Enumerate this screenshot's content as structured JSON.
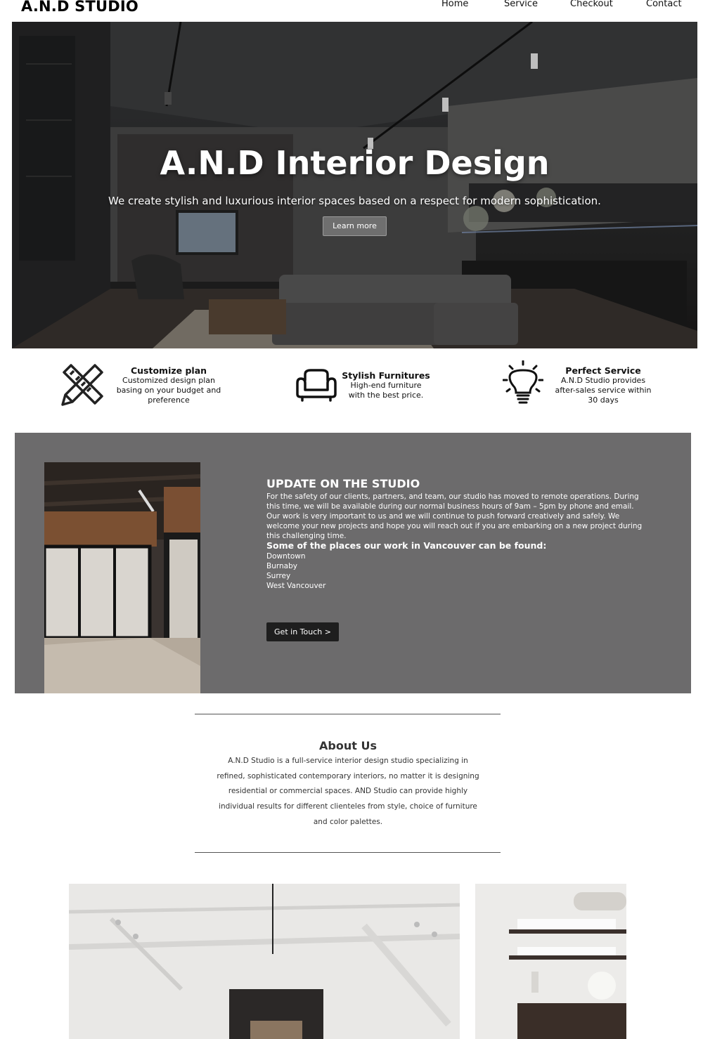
{
  "brand": "A.N.D STUDIO",
  "nav": [
    "Home",
    "Service",
    "Checkout",
    "Contact"
  ],
  "hero": {
    "title": "A.N.D Interior Design",
    "subtitle": "We create stylish and luxurious interior spaces based on a respect for modern sophistication.",
    "button": "Learn more"
  },
  "features": [
    {
      "icon": "ruler-pencil-icon",
      "title": "Customize plan",
      "lines": [
        "Customized design plan",
        "basing on your budget and",
        "preference"
      ]
    },
    {
      "icon": "armchair-icon",
      "title": "Stylish Furnitures",
      "lines": [
        "High-end furniture",
        "with the best price."
      ]
    },
    {
      "icon": "lightbulb-icon",
      "title": "Perfect Service",
      "lines": [
        "A.N.D Studio provides",
        "after-sales service within",
        "30 days"
      ]
    }
  ],
  "update": {
    "title": "UPDATE ON THE STUDIO",
    "body": "For the safety of our clients, partners, and team, our studio has moved to remote operations. During this time, we will be available during our normal business hours of 9am – 5pm by phone and email. Our work is very important to us and we will continue to push forward creatively and safely. We welcome your new projects and hope you will reach out if you are embarking on a new project during this challenging time.",
    "places_title": "Some of the places our work in Vancouver can be found:",
    "places": [
      "Downtown",
      "Burnaby",
      "Surrey",
      "West Vancouver"
    ],
    "button": "Get in Touch >"
  },
  "about": {
    "title": "About Us",
    "body": "A.N.D Studio is a full-service interior design studio specializing in refined, sophisticated contemporary interiors, no matter it is designing residential or commercial spaces. AND Studio can provide highly individual results for different clienteles from style, choice of furniture and color palettes."
  },
  "colors": {
    "update_bg": "#6c6b6c",
    "button_dark": "#1e1e1e",
    "hero_button": "#787878"
  }
}
